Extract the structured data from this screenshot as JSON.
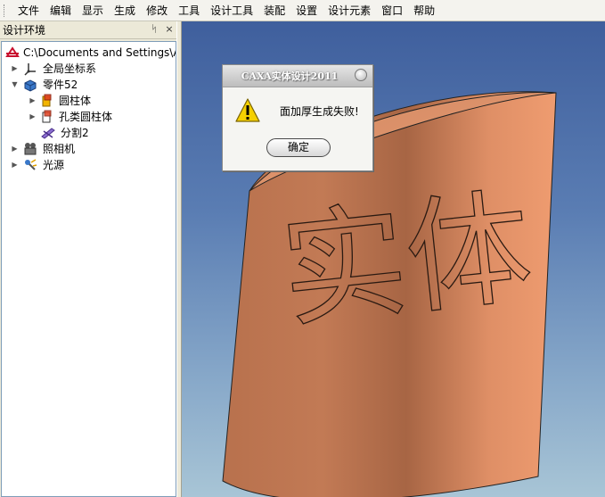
{
  "menu": [
    "文件",
    "编辑",
    "显示",
    "生成",
    "修改",
    "工具",
    "设计工具",
    "装配",
    "设置",
    "设计元素",
    "窗口",
    "帮助"
  ],
  "panel": {
    "title": "设计环境",
    "pin_glyph": "ᛋ",
    "close_glyph": "×"
  },
  "tree": {
    "root": "C:\\Documents and Settings\\Admini",
    "world_cs": "全局坐标系",
    "part": "零件52",
    "cylinder": "圆柱体",
    "hole_cylinder": "孔类圆柱体",
    "split": "分割2",
    "camera": "照相机",
    "light": "光源"
  },
  "viewport": {
    "engraved_text": "实体"
  },
  "dialog": {
    "title": "CAXA实体设计2011",
    "message": "面加厚生成失败!",
    "ok_label": "确定"
  },
  "colors": {
    "cylinder": "#e0916a",
    "background_top": "#3f5f9d",
    "background_bottom": "#a8c5d6",
    "warning": "#f5d000"
  }
}
